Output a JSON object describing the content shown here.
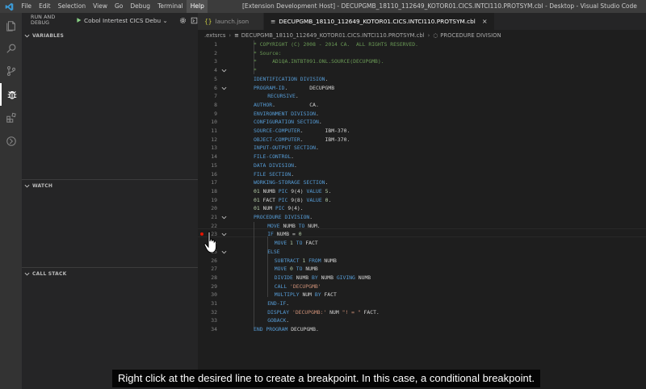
{
  "titlebar": {
    "menu": [
      "File",
      "Edit",
      "Selection",
      "View",
      "Go",
      "Debug",
      "Terminal",
      "Help"
    ],
    "active_menu_index": 7,
    "window_title": "[Extension Development Host] - DECUPGMB_18110_112649_KOTOR01.CICS.INTCI110.PROTSYM.cbl - Desktop - Visual Studio Code"
  },
  "activitybar": {
    "icons": [
      "explorer-icon",
      "search-icon",
      "source-control-icon",
      "debug-icon",
      "extensions-icon",
      "remote-icon"
    ],
    "active": "debug-icon"
  },
  "sidebar": {
    "debug_title": "RUN AND DEBUG",
    "config": "Cobol Intertest CICS Debu",
    "panels": [
      "VARIABLES",
      "WATCH",
      "CALL STACK"
    ]
  },
  "tabs": [
    {
      "label": "launch.json",
      "icon": "{}",
      "active": false
    },
    {
      "label": "DECUPGMB_18110_112649_KOTOR01.CICS.INTCI110.PROTSYM.cbl",
      "icon": "≡",
      "active": true
    }
  ],
  "breadcrumb": {
    "items": [
      ".extsrcs",
      "DECUPGMB_18110_112649_KOTOR01.CICS.INTCI110.PROTSYM.cbl",
      "PROCEDURE DIVISION"
    ]
  },
  "editor": {
    "breakpoint_line": 23,
    "lines": [
      {
        "n": "1",
        "text": "* COPYRIGHT (C) 2008 - 2014 CA.  ALL RIGHTS RESERVED.",
        "cls": "cm",
        "indent": 0
      },
      {
        "n": "2",
        "text": "* Source:",
        "cls": "cm",
        "indent": 0
      },
      {
        "n": "3",
        "text": "*     AD1QA.INTBT091.ONL.SOURCE(DECUPGMB).",
        "cls": "cm",
        "indent": 0
      },
      {
        "n": "4",
        "text": "*",
        "cls": "cm",
        "indent": 0,
        "fold": true
      },
      {
        "n": "5",
        "text": "IDENTIFICATION DIVISION.",
        "cls": "kw",
        "indent": 0
      },
      {
        "n": "6",
        "text": "PROGRAM-ID.       DECUPGMB",
        "cls": "mix1",
        "indent": 0,
        "fold": true
      },
      {
        "n": "7",
        "text": "RECURSIVE.",
        "cls": "kw",
        "indent": 4
      },
      {
        "n": "8",
        "text": "AUTHOR.           CA.",
        "cls": "kw",
        "indent": 0
      },
      {
        "n": "9",
        "text": "ENVIRONMENT DIVISION.",
        "cls": "kw",
        "indent": 0
      },
      {
        "n": "10",
        "text": "CONFIGURATION SECTION.",
        "cls": "kw",
        "indent": 0
      },
      {
        "n": "11",
        "text": "SOURCE-COMPUTER.       IBM-370.",
        "cls": "kw",
        "indent": 0
      },
      {
        "n": "12",
        "text": "OBJECT-COMPUTER.       IBM-370.",
        "cls": "kw",
        "indent": 0
      },
      {
        "n": "13",
        "text": "INPUT-OUTPUT SECTION.",
        "cls": "kw",
        "indent": 0
      },
      {
        "n": "14",
        "text": "FILE-CONTROL.",
        "cls": "kw",
        "indent": 0
      },
      {
        "n": "15",
        "text": "DATA DIVISION.",
        "cls": "kw",
        "indent": 0
      },
      {
        "n": "16",
        "text": "FILE SECTION.",
        "cls": "kw",
        "indent": 0
      },
      {
        "n": "17",
        "text": "WORKING-STORAGE SECTION.",
        "cls": "kw",
        "indent": 0
      },
      {
        "n": "18",
        "text": "01 NUMB PIC 9(4) VALUE 5.",
        "cls": "pic",
        "indent": 0
      },
      {
        "n": "19",
        "text": "01 FACT PIC 9(8) VALUE 0.",
        "cls": "pic",
        "indent": 0
      },
      {
        "n": "20",
        "text": "01 NUM PIC 9(4).",
        "cls": "pic",
        "indent": 0
      },
      {
        "n": "21",
        "text": "PROCEDURE DIVISION.",
        "cls": "kw",
        "indent": 0,
        "fold": true
      },
      {
        "n": "22",
        "text": "MOVE NUMB TO NUM.",
        "cls": "stmt",
        "indent": 4
      },
      {
        "n": "23",
        "text": "IF NUMB = 0",
        "cls": "stmt",
        "indent": 4,
        "fold": true
      },
      {
        "n": "24",
        "text": "MOVE 1 TO FACT",
        "cls": "stmt",
        "indent": 6
      },
      {
        "n": "25",
        "text": "ELSE",
        "cls": "kw",
        "indent": 4,
        "fold": true
      },
      {
        "n": "26",
        "text": "SUBTRACT 1 FROM NUMB",
        "cls": "stmt",
        "indent": 6
      },
      {
        "n": "27",
        "text": "MOVE 0 TO NUMB",
        "cls": "stmt",
        "indent": 6
      },
      {
        "n": "28",
        "text": "DIVIDE NUMB BY NUMB GIVING NUMB",
        "cls": "stmt",
        "indent": 6
      },
      {
        "n": "29",
        "text": "CALL 'DECUPGMB'",
        "cls": "call",
        "indent": 6
      },
      {
        "n": "30",
        "text": "MULTIPLY NUM BY FACT",
        "cls": "stmt",
        "indent": 6
      },
      {
        "n": "31",
        "text": "END-IF.",
        "cls": "kw",
        "indent": 4
      },
      {
        "n": "32",
        "text": "DISPLAY 'DECUPGMB:' NUM \"! = \" FACT.",
        "cls": "disp",
        "indent": 4
      },
      {
        "n": "33",
        "text": "GOBACK.",
        "cls": "kw",
        "indent": 4
      },
      {
        "n": "34",
        "text": "END PROGRAM DECUPGMB.",
        "cls": "endp",
        "indent": 0
      }
    ]
  },
  "caption": "Right click at the desired line to create a breakpoint. In this case, a conditional breakpoint."
}
